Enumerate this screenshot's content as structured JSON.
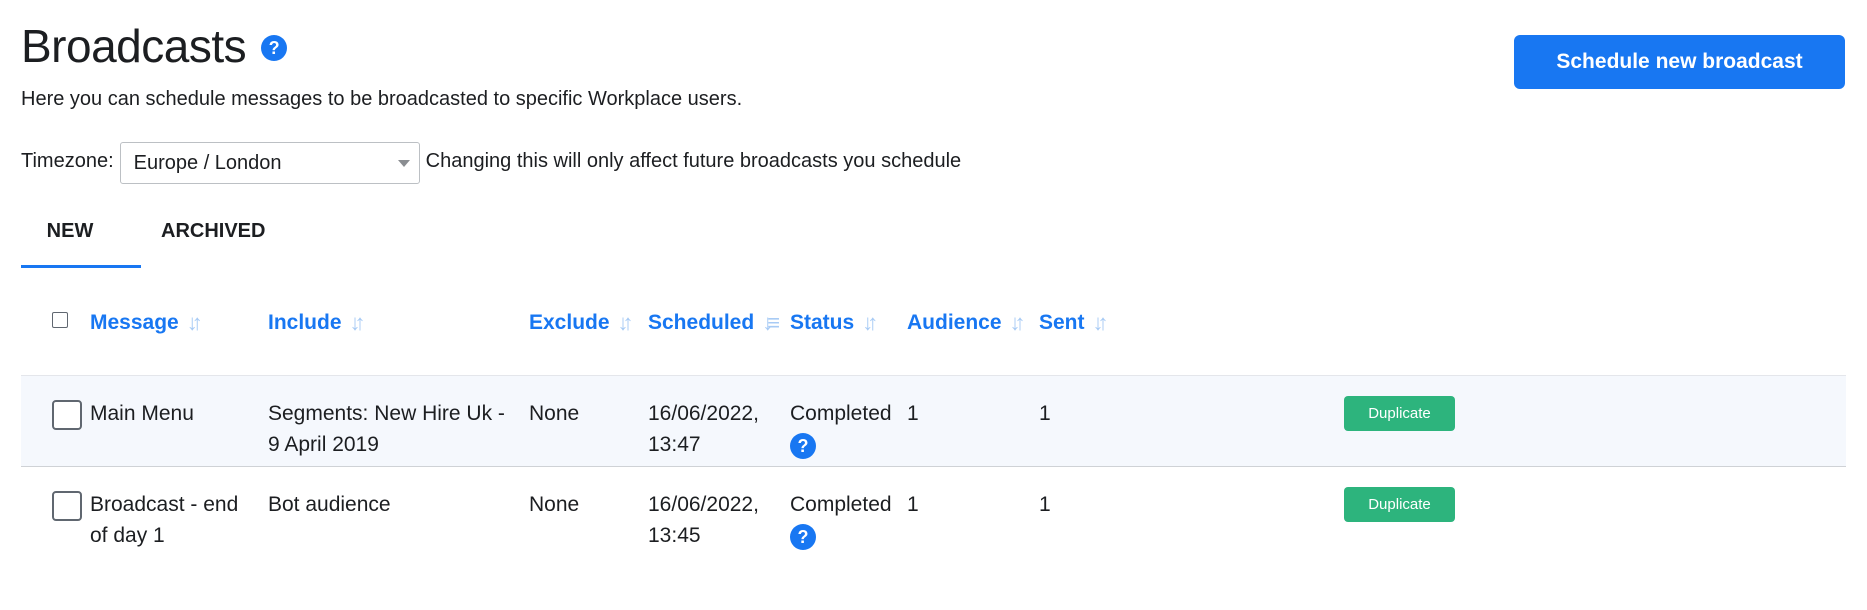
{
  "header": {
    "title": "Broadcasts",
    "help_icon": "question-circle-icon",
    "help_glyph": "?",
    "subtitle": "Here you can schedule messages to be broadcasted to specific Workplace users.",
    "primary_action": "Schedule new broadcast"
  },
  "timezone": {
    "label": "Timezone:",
    "value": "Europe / London",
    "note": "Changing this will only affect future broadcasts you schedule"
  },
  "tabs": [
    {
      "label": "NEW",
      "active": true
    },
    {
      "label": "ARCHIVED",
      "active": false
    }
  ],
  "table": {
    "columns": {
      "message": "Message",
      "include": "Include",
      "exclude": "Exclude",
      "scheduled": "Scheduled",
      "status": "Status",
      "audience": "Audience",
      "sent": "Sent"
    },
    "sort_icon": "sort-arrows-icon",
    "rows": [
      {
        "message": "Main Menu",
        "include": "Segments: New Hire Uk - 9 April 2019",
        "exclude": "None",
        "scheduled": "16/06/2022, 13:47",
        "status": "Completed",
        "audience": "1",
        "sent": "1",
        "action": "Duplicate"
      },
      {
        "message": "Broadcast - end of day 1",
        "include": "Bot audience",
        "exclude": "None",
        "scheduled": "16/06/2022, 13:45",
        "status": "Completed",
        "audience": "1",
        "sent": "1",
        "action": "Duplicate"
      }
    ]
  },
  "colors": {
    "accent": "#1877f2",
    "duplicate": "#2db47d",
    "row_highlight": "#f5f8fd"
  }
}
